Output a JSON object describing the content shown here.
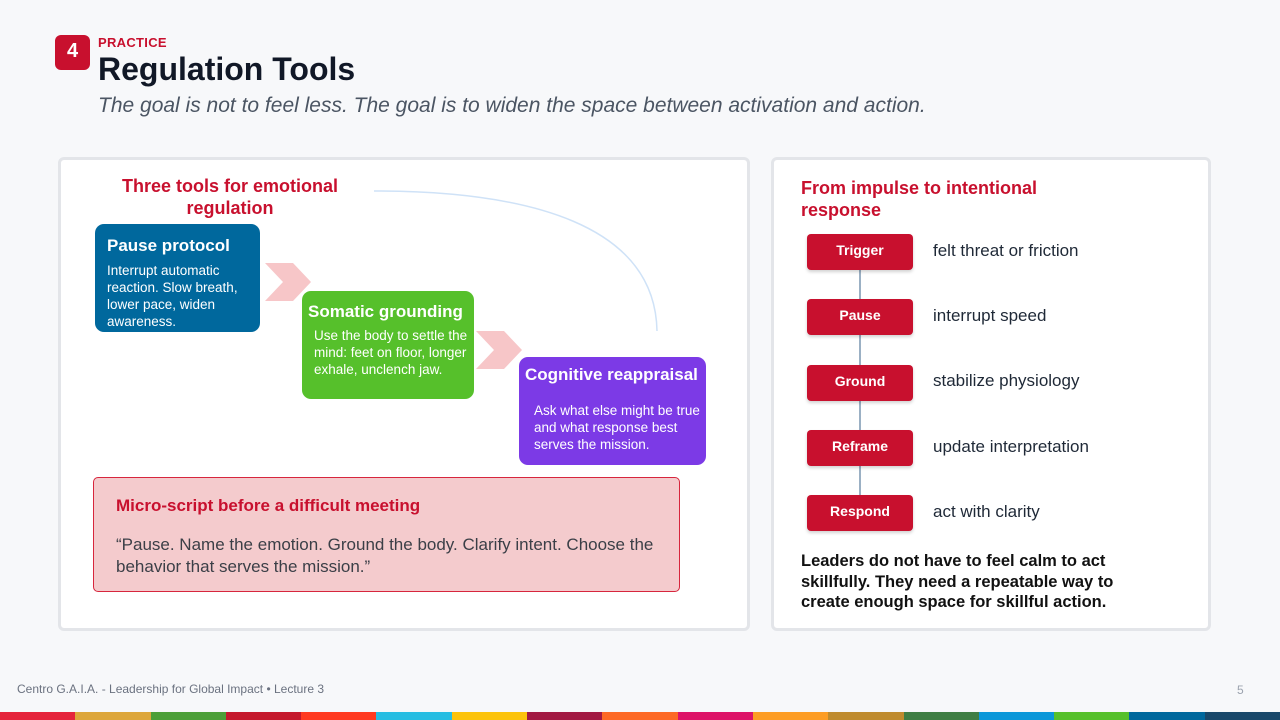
{
  "header": {
    "badge_number": "4",
    "kicker": "PRACTICE",
    "title": "Regulation Tools",
    "subtitle": "The goal is not to feel less. The goal is to widen the space between activation and action."
  },
  "tools": {
    "heading": "Three tools for emotional regulation",
    "items": [
      {
        "title": "Pause protocol",
        "text": "Interrupt automatic reaction. Slow breath, lower pace, widen awareness.",
        "color": "#00689d"
      },
      {
        "title": "Somatic grounding",
        "text": "Use the body to settle the mind: feet on floor, longer exhale, unclench jaw.",
        "color": "#56c02b"
      },
      {
        "title": "Cognitive reappraisal",
        "text": "Ask what else might be true and what response best serves the mission.",
        "color": "#7c3ae6"
      }
    ]
  },
  "micro_script": {
    "heading": "Micro-script before a difficult meeting",
    "quote": "“Pause. Name the emotion. Ground the body. Clarify intent. Choose the behavior that serves the mission.”"
  },
  "flow": {
    "heading": "From impulse to intentional response",
    "steps": [
      {
        "label": "Trigger",
        "desc": "felt threat or friction"
      },
      {
        "label": "Pause",
        "desc": "interrupt speed"
      },
      {
        "label": "Ground",
        "desc": "stabilize physiology"
      },
      {
        "label": "Reframe",
        "desc": "update interpretation"
      },
      {
        "label": "Respond",
        "desc": "act with clarity"
      }
    ],
    "closing": "Leaders do not have to feel calm to act skillfully. They need a repeatable way to create enough space for skillful action."
  },
  "footer": {
    "text": "Centro G.A.I.A. - Leadership for Global Impact • Lecture 3",
    "page": "5"
  },
  "colors": {
    "accent": "#c8102e",
    "stripes": [
      "#e5243b",
      "#dda63a",
      "#4c9f38",
      "#c5192d",
      "#ff3a21",
      "#26bde2",
      "#fcc30b",
      "#a21942",
      "#fd6925",
      "#dd1367",
      "#fd9d24",
      "#bf8b2e",
      "#3f7e44",
      "#0a97d9",
      "#56c02b",
      "#00689d",
      "#19486a"
    ]
  }
}
